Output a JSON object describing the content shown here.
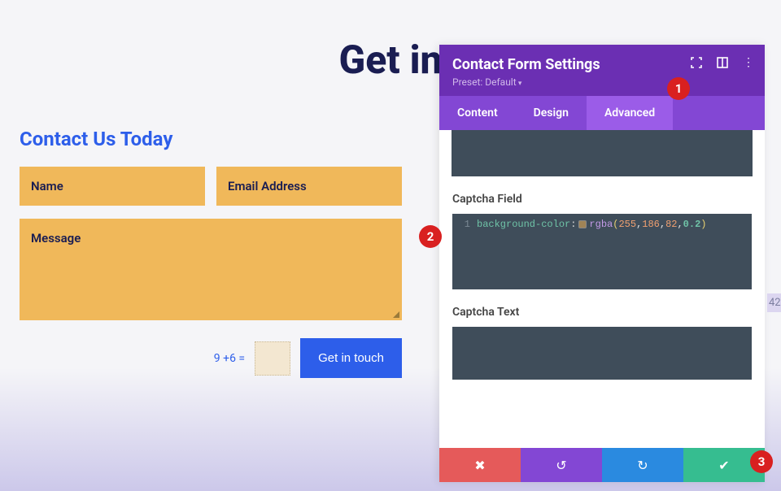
{
  "page": {
    "heading": "Get in",
    "section_heading": "Contact Us Today"
  },
  "form": {
    "name_placeholder": "Name",
    "email_placeholder": "Email Address",
    "message_placeholder": "Message",
    "captcha_equation": "9 +6 =",
    "submit_label": "Get in touch"
  },
  "panel": {
    "title": "Contact Form Settings",
    "preset": "Preset: Default",
    "tabs": {
      "content": "Content",
      "design": "Design",
      "advanced": "Advanced"
    },
    "sections": {
      "captcha_field": "Captcha Field",
      "captcha_text": "Captcha Text"
    },
    "code": {
      "line_num": "1",
      "prop": "background-color",
      "colon": ":",
      "func": "rgba",
      "n1": "255",
      "n2": "186",
      "n3": "82",
      "alpha": "0.2"
    }
  },
  "annotations": {
    "one": "1",
    "two": "2",
    "three": "3"
  },
  "edge_num": "42"
}
